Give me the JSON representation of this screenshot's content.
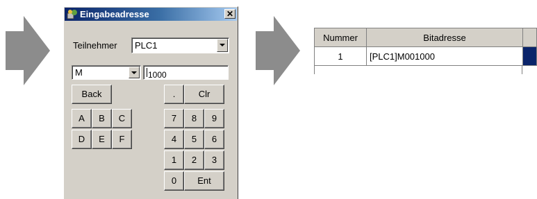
{
  "dialog": {
    "title": "Eingabeadresse",
    "close_label": "✕",
    "teilnehmer_label": "Teilnehmer",
    "teilnehmer_value": "PLC1",
    "device_value": "M",
    "address_value": "1000",
    "keys": {
      "back": "Back",
      "dot": ".",
      "clr": "Clr",
      "a": "A",
      "b": "B",
      "c": "C",
      "d": "D",
      "e": "E",
      "f": "F",
      "k7": "7",
      "k8": "8",
      "k9": "9",
      "k4": "4",
      "k5": "5",
      "k6": "6",
      "k1": "1",
      "k2": "2",
      "k3": "3",
      "k0": "0",
      "ent": "Ent"
    }
  },
  "table": {
    "headers": [
      "Nummer",
      "Bitadresse"
    ],
    "rows": [
      [
        "1",
        "[PLC1]M001000"
      ]
    ]
  },
  "icons": [
    "arrow-right-icon",
    "dialog-app-icon",
    "close-icon",
    "dropdown-arrow-icon"
  ],
  "colors": {
    "arrow": "#8c8c8c",
    "selection": "#0a246a",
    "titlebar": "#0a246a"
  }
}
